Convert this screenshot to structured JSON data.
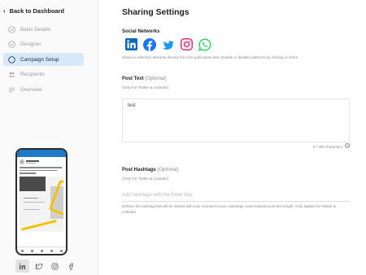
{
  "sidebar": {
    "back_label": "Back to Dashboard",
    "items": [
      {
        "label": "Basic Details",
        "icon": "check-circle-icon"
      },
      {
        "label": "Designer",
        "icon": "check-circle-icon"
      },
      {
        "label": "Campaign Setup",
        "icon": "circle-icon",
        "active": true
      },
      {
        "label": "Recipients",
        "icon": "people-icon"
      },
      {
        "label": "Overview",
        "icon": "list-icon"
      }
    ],
    "preview_tabs": [
      "linkedin-icon",
      "twitter-icon",
      "instagram-icon",
      "facebook-icon"
    ]
  },
  "main": {
    "title": "Sharing Settings",
    "social": {
      "label": "Social Networks",
      "networks": [
        "LinkedIn",
        "Facebook",
        "Twitter",
        "Instagram",
        "WhatsApp"
      ],
      "hint": "Share to selected networks directly from the participant view. Enable or disable platforms by clicking on them."
    },
    "post_text": {
      "label": "Post Text",
      "optional": "(Optional)",
      "note": "(Only For Twitter & LinkedIn)",
      "value": "test",
      "counter": "5 / 280 characters"
    },
    "hashtags": {
      "label": "Post Hashtags",
      "optional": "(Optional)",
      "note": "(Only For Twitter & LinkedIn)",
      "placeholder": "Add hashtags with the Enter key",
      "description": "Defines the hashtag that will be shared with your recipient's post. Hashtags count towards post text length. Only applies for Twitter & LinkedIn."
    }
  },
  "colors": {
    "active_bg": "#d6e9fb",
    "linkedin": "#0a66c2",
    "facebook": "#1877f2",
    "twitter": "#1d9bf0",
    "instagram": "#e1306c",
    "whatsapp": "#25d366"
  }
}
